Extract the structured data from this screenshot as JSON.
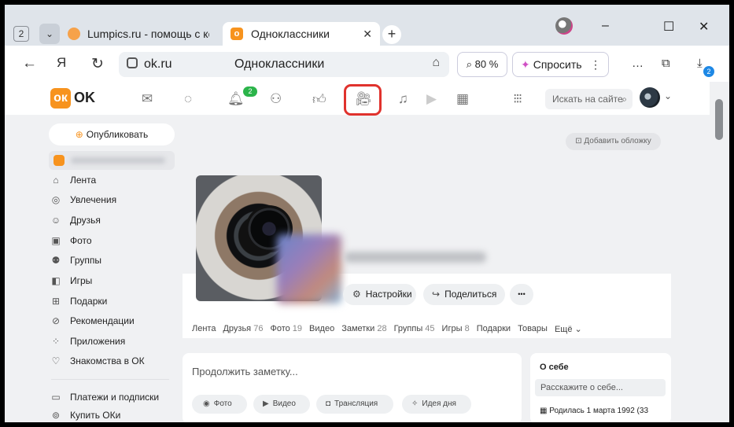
{
  "browser": {
    "tab_count": "2",
    "tabs": [
      {
        "label": "Lumpics.ru - помощь с ком",
        "favicon": "lumpics-favicon"
      },
      {
        "label": "Одноклассники",
        "favicon": "ok-favicon",
        "close": "✕"
      }
    ],
    "new_tab": "+",
    "window_controls": {
      "minimize": "–",
      "maximize": "☐",
      "close": "✕"
    },
    "nav": {
      "back": "←",
      "yandex": "Я",
      "reload": "↻"
    },
    "url": {
      "host": "ok.ru",
      "page_title": "Одноклассники",
      "bookmark": "⌂"
    },
    "zoom": "⌕ 80 %",
    "ask": {
      "icon": "✦",
      "label": "Спросить",
      "more": "⋮"
    },
    "toolbar": {
      "more": "…",
      "extensions": "⧉",
      "downloads": "⤓",
      "downloads_badge": "2"
    }
  },
  "ok_header": {
    "logo_letter": "ок",
    "logo_text": "OK",
    "icons": [
      {
        "name": "messages-icon",
        "glyph": "✉"
      },
      {
        "name": "discussions-icon",
        "glyph": "◌"
      },
      {
        "name": "notifications-icon",
        "glyph": "🔔︎"
      },
      {
        "name": "guests-icon",
        "glyph": "⚇"
      },
      {
        "name": "likes-icon",
        "glyph": "👍︎"
      },
      {
        "name": "video-icon",
        "glyph": "🎥︎"
      },
      {
        "name": "music-icon",
        "glyph": "♫"
      },
      {
        "name": "games-icon",
        "glyph": "▶"
      },
      {
        "name": "calendar-icon",
        "glyph": "▦"
      },
      {
        "name": "apps-icon",
        "glyph": "⁝⁝⁝"
      }
    ],
    "notifications_badge": "2",
    "search_placeholder": "Искать на сайте",
    "search_icon": "⌕",
    "avatar_dropdown": "⌄",
    "highlight_color": "#e0322d"
  },
  "sidebar": {
    "publish": {
      "icon": "⊕",
      "label": "Опубликовать"
    },
    "items": [
      {
        "icon": "⌂",
        "label": "Лента"
      },
      {
        "icon": "◎",
        "label": "Увлечения"
      },
      {
        "icon": "☺",
        "label": "Друзья"
      },
      {
        "icon": "▣",
        "label": "Фото"
      },
      {
        "icon": "⚉",
        "label": "Группы"
      },
      {
        "icon": "◧",
        "label": "Игры"
      },
      {
        "icon": "⊞",
        "label": "Подарки"
      },
      {
        "icon": "⊘",
        "label": "Рекомендации"
      },
      {
        "icon": "⁘",
        "label": "Приложения"
      },
      {
        "icon": "♡",
        "label": "Знакомства в ОК"
      },
      {
        "icon": "▭",
        "label": "Платежи и подписки"
      },
      {
        "icon": "⊚",
        "label": "Купить ОКи"
      }
    ]
  },
  "profile": {
    "add_cover": "Добавить обложку",
    "add_cover_icon": "⊡",
    "buttons": [
      {
        "icon": "⚙",
        "label": "Настройки"
      },
      {
        "icon": "↪",
        "label": "Поделиться"
      },
      {
        "icon": "",
        "label": "•••"
      }
    ],
    "tabs": [
      {
        "label": "Лента",
        "count": ""
      },
      {
        "label": "Друзья",
        "count": "76"
      },
      {
        "label": "Фото",
        "count": "19"
      },
      {
        "label": "Видео",
        "count": ""
      },
      {
        "label": "Заметки",
        "count": "28"
      },
      {
        "label": "Группы",
        "count": "45"
      },
      {
        "label": "Игры",
        "count": "8"
      },
      {
        "label": "Подарки",
        "count": ""
      },
      {
        "label": "Товары",
        "count": ""
      },
      {
        "label": "Ещё ⌄",
        "count": ""
      }
    ]
  },
  "note": {
    "placeholder": "Продолжить заметку...",
    "buttons": [
      {
        "icon": "◉",
        "label": "Фото"
      },
      {
        "icon": "▶",
        "label": "Видео"
      },
      {
        "icon": "◘",
        "label": "Трансляция"
      },
      {
        "icon": "✧",
        "label": "Идея дня"
      }
    ]
  },
  "about": {
    "title": "О себе",
    "placeholder": "Расскажите о себе...",
    "birthday": "▦ Родилась 1 марта 1992 (33"
  }
}
